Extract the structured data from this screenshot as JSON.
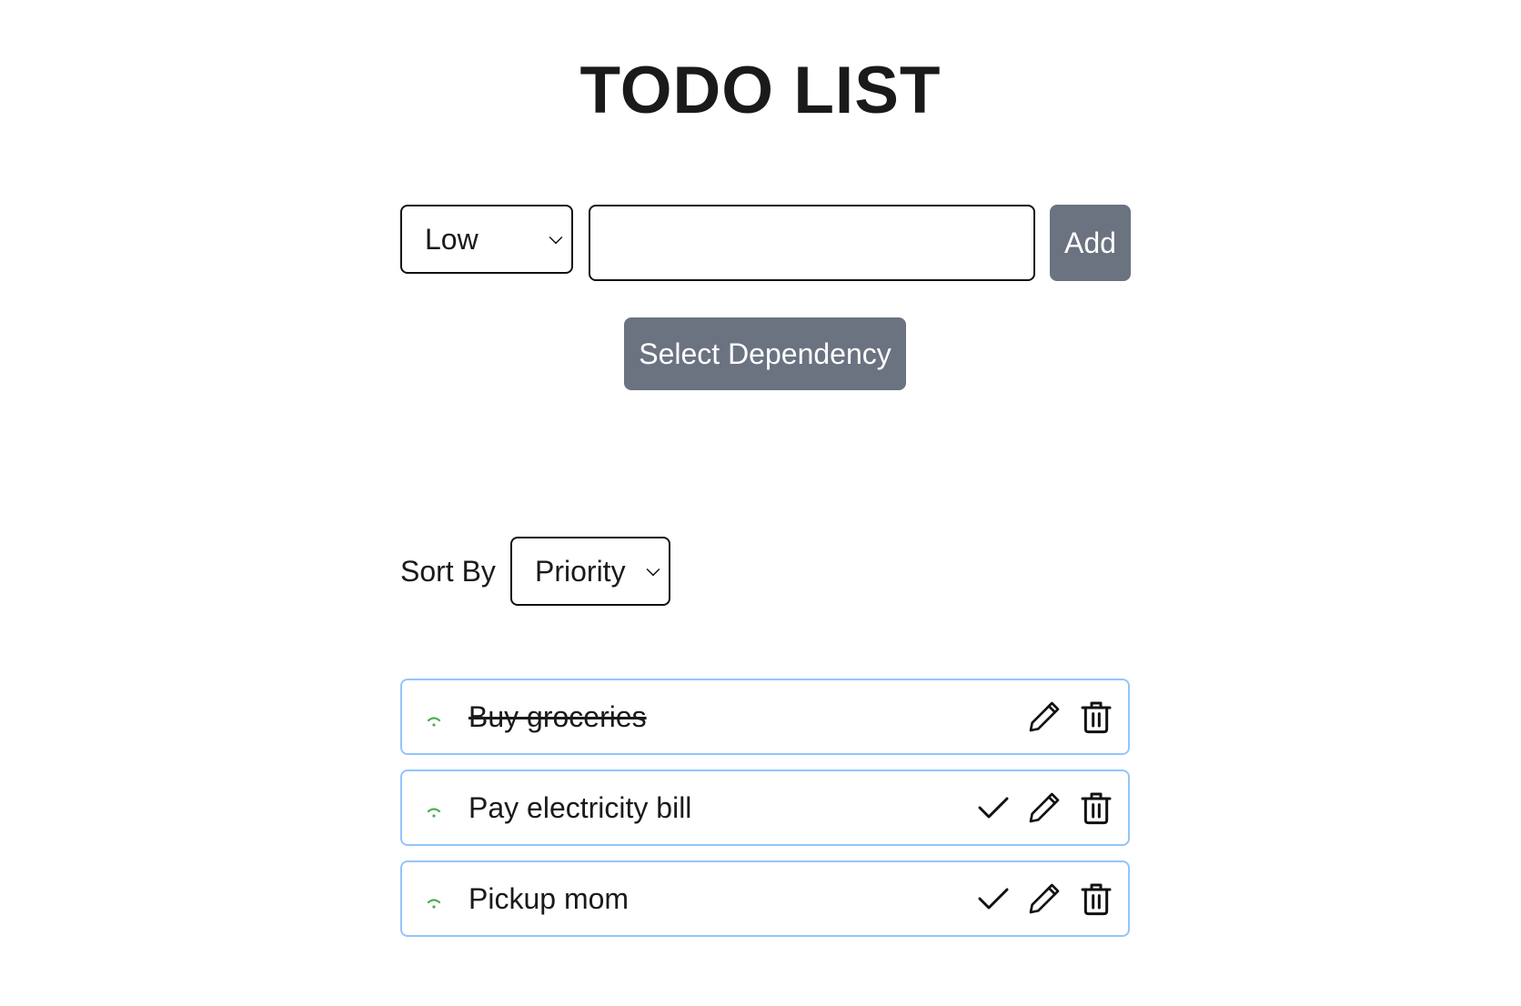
{
  "page_title": "TODO LIST",
  "add_form": {
    "priority_value": "Low",
    "task_input_value": "",
    "task_input_placeholder": "",
    "add_label": "Add",
    "dependency_label": "Select Dependency"
  },
  "sort": {
    "label": "Sort By",
    "value": "Priority"
  },
  "todos": [
    {
      "text": "Buy groceries",
      "completed": true,
      "priority_icon": "low-priority-signal-icon"
    },
    {
      "text": "Pay electricity bill",
      "completed": false,
      "priority_icon": "low-priority-signal-icon"
    },
    {
      "text": "Pickup mom",
      "completed": false,
      "priority_icon": "low-priority-signal-icon"
    }
  ],
  "colors": {
    "button_bg": "#6b7280",
    "item_border": "#93c5fd",
    "priority_low": "#4caf50"
  },
  "icons": {
    "complete": "check-icon",
    "edit": "pencil-icon",
    "delete": "trash-icon"
  }
}
